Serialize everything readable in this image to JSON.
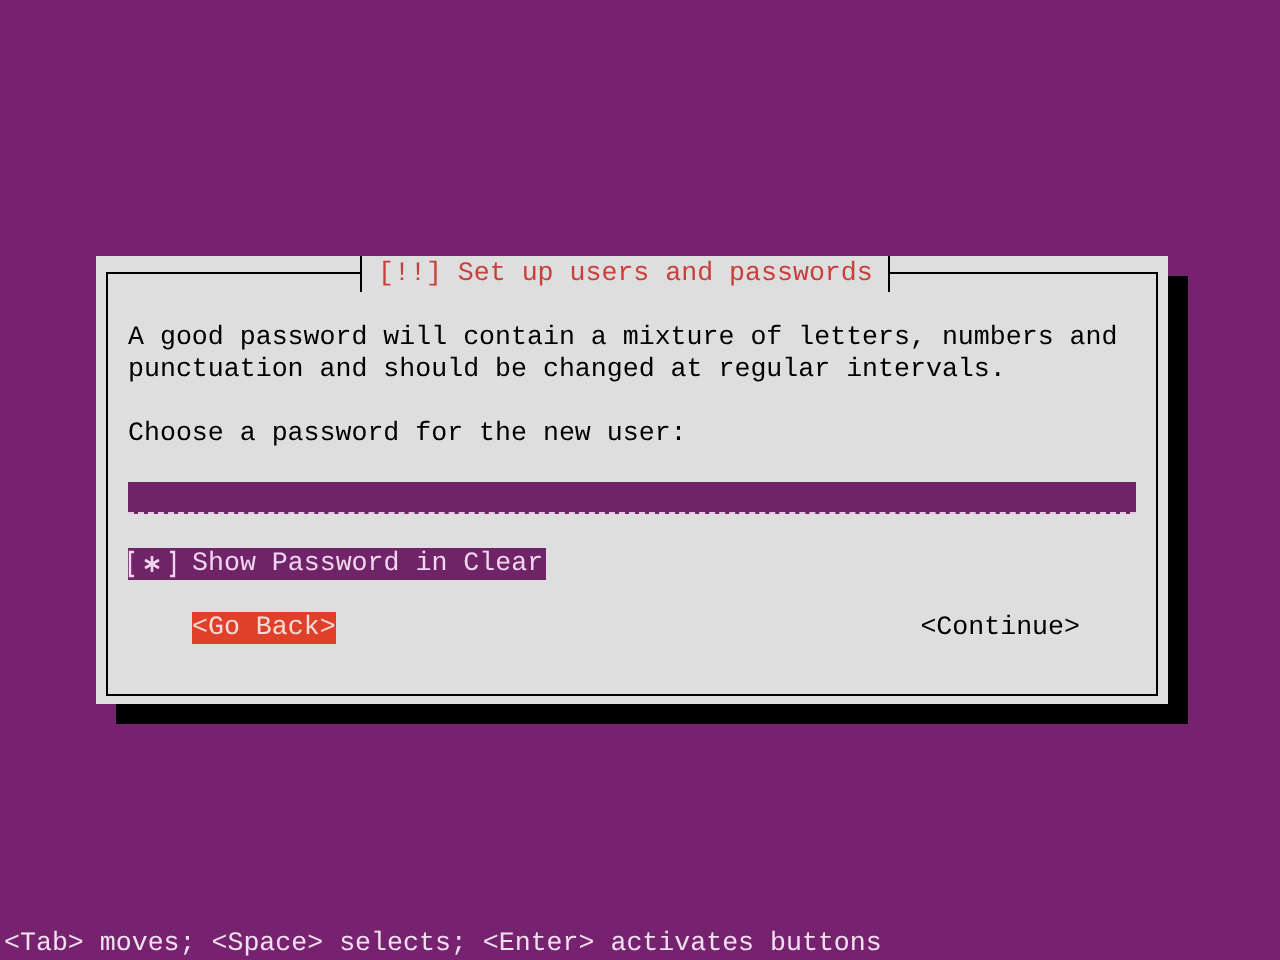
{
  "dialog": {
    "title": "[!!] Set up users and passwords",
    "description": "A good password will contain a mixture of letters, numbers and punctuation and should be changed at regular intervals.",
    "prompt": "Choose a password for the new user:",
    "password_field": {
      "selected": false
    },
    "checkbox": {
      "label": "Show Password in Clear",
      "checked": true,
      "selected": true
    },
    "buttons": [
      {
        "label": "<Go Back>",
        "selected": true
      },
      {
        "label": "<Continue>",
        "selected": false
      }
    ]
  },
  "status_bar": "<Tab> moves; <Space> selects; <Enter> activates buttons"
}
